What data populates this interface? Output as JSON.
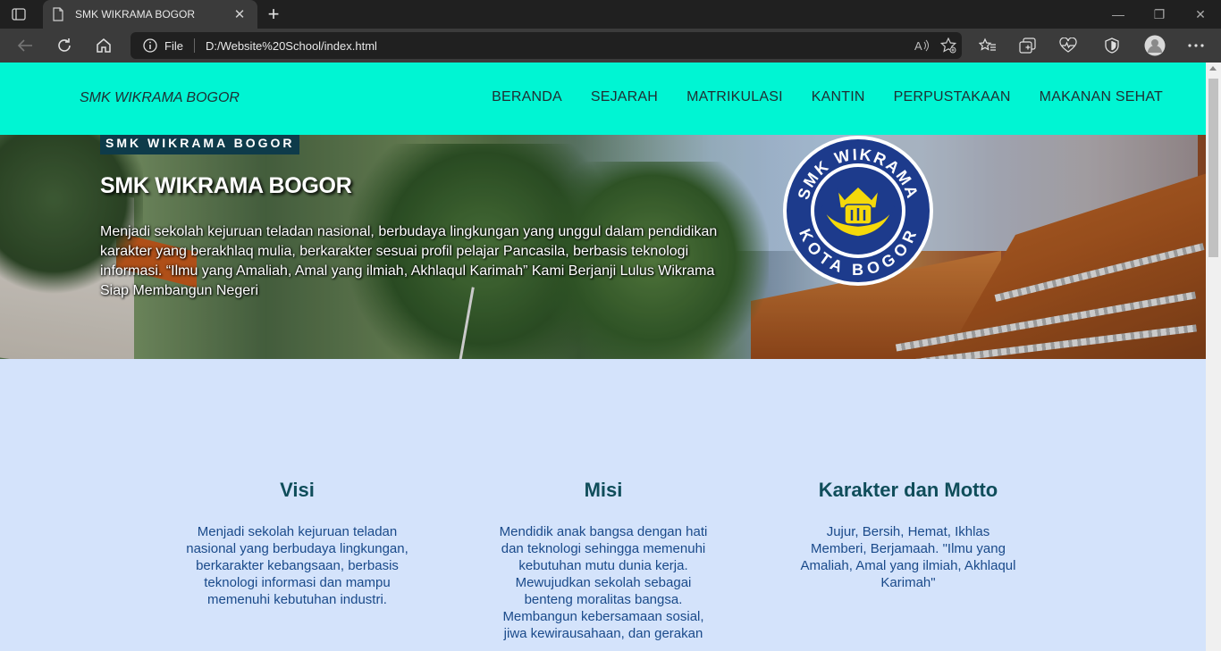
{
  "browser": {
    "tab_title": "SMK WIKRAMA BOGOR",
    "address_prefix": "File",
    "url": "D:/Website%20School/index.html",
    "icons": [
      "tab-actions-icon",
      "document-icon",
      "close-icon",
      "new-tab-icon",
      "minimize-icon",
      "restore-icon",
      "window-close-icon",
      "back-icon",
      "refresh-icon",
      "home-icon",
      "info-icon",
      "read-aloud-icon",
      "add-favorite-icon",
      "favorites-icon",
      "collections-icon",
      "health-icon",
      "security-icon",
      "profile-avatar",
      "more-icon"
    ]
  },
  "site": {
    "brand": "SMK WIKRAMA BOGOR",
    "nav": [
      "BERANDA",
      "SEJARAH",
      "MATRIKULASI",
      "KANTIN",
      "PERPUSTAKAAN",
      "MAKANAN SEHAT"
    ],
    "hero": {
      "tag": "SMK WIKRAMA BOGOR",
      "title": "SMK WIKRAMA BOGOR",
      "text": "Menjadi sekolah kejuruan teladan nasional, berbudaya lingkungan yang unggul dalam pendidikan karakter yang berakhlaq mulia, berkarakter sesuai profil pelajar Pancasila, berbasis teknologi informasi. “Ilmu yang Amaliah, Amal yang ilmiah, Akhlaqul Karimah” Kami Berjanji Lulus Wikrama Siap Membangun Negeri",
      "logo_top": "SMK WIKRAMA",
      "logo_bottom": "KOTA BOGOR"
    },
    "columns": [
      {
        "title": "Visi",
        "text": "Menjadi sekolah kejuruan teladan nasional yang berbudaya lingkungan, berkarakter kebangsaan, berbasis teknologi informasi dan mampu memenuhi kebutuhan industri."
      },
      {
        "title": "Misi",
        "text": "Mendidik anak bangsa dengan hati dan teknologi sehingga memenuhi kebutuhan mutu dunia kerja. Mewujudkan sekolah sebagai benteng moralitas bangsa. Membangun kebersamaan sosial, jiwa kewirausahaan, dan gerakan"
      },
      {
        "title": "Karakter dan Motto",
        "text": "Jujur, Bersih, Hemat, Ikhlas Memberi, Berjamaah. \"Ilmu yang Amaliah, Amal yang ilmiah, Akhlaqul Karimah\""
      }
    ]
  },
  "colors": {
    "nav_bg": "#00f5d3",
    "page_bg": "#d4e3fb",
    "heading": "#0f4d5a",
    "body_text": "#1a4a8a",
    "tag_bg": "#0e3b4a"
  }
}
